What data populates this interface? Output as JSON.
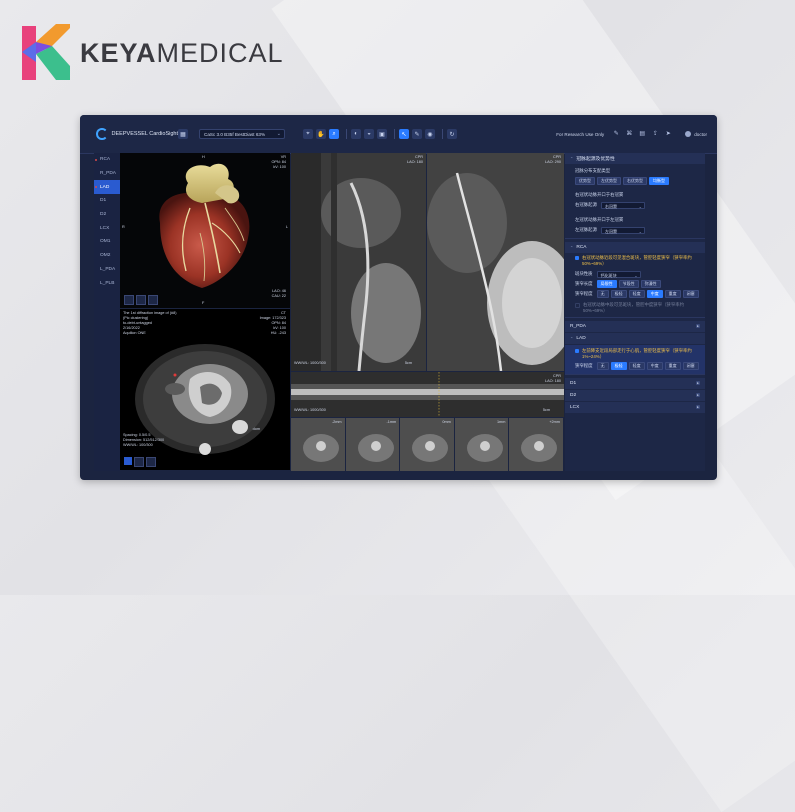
{
  "logo": {
    "bold": "KEYA",
    "regular": "MEDICAL"
  },
  "app": {
    "brand": "DEEPVESSEL CardioSight",
    "series": "CaSc 3.0 B35f BestDiast 63%",
    "research_note": "For Research Use Only",
    "user": "doctor",
    "tool_icons": [
      "grid-icon",
      "target-icon",
      "hand-icon",
      "zoom-icon",
      "contrast-icon",
      "window-icon",
      "camera-icon",
      "cursor-icon",
      "brush-icon",
      "eye-icon",
      "refresh-icon"
    ],
    "right_icons": [
      "edit-icon",
      "network-icon",
      "report-icon",
      "export-icon",
      "send-icon"
    ]
  },
  "vessels": [
    {
      "label": "RCA",
      "flag": true
    },
    {
      "label": "R_PDA",
      "flag": false
    },
    {
      "label": "LAD",
      "flag": true,
      "active": true
    },
    {
      "label": "D1",
      "flag": false
    },
    {
      "label": "D2",
      "flag": false
    },
    {
      "label": "LCX",
      "flag": false
    },
    {
      "label": "OM1",
      "flag": false
    },
    {
      "label": "OM2",
      "flag": false
    },
    {
      "label": "L_PDA",
      "flag": false
    },
    {
      "label": "L_PLB",
      "flag": false
    }
  ],
  "vr_view": {
    "top": "H",
    "tr": "VR\nOPN: 84\nkV: 100",
    "br": "LAO: 46\nCAU: 22",
    "bottom": "F",
    "left": "R",
    "right": "L"
  },
  "axial_view": {
    "tl": "The 1st diffraction image of (#8)\n(Pic clustering)\nto-debt-untagged\n2/16/2022\nAquilion ONE",
    "tr": "CT\nImage: 172/323\nOPN: 84\nkV: 100\nHU: -243",
    "bl": "Spacing: 0.5/0.5\nDimension: 512/512/300\nWW/WL: 100/300",
    "side_r": "dom"
  },
  "cpr_view": {
    "tr1": "CPR\nLAO: 180",
    "tr2": "CPR\nLAO: 290",
    "bl": "WW/WL: 1000/300",
    "scale": "5cm",
    "top": "H"
  },
  "straight_view": {
    "tr": "CPR\nLAO: 180",
    "bl": "WW/WL: 1000/300",
    "scale": "5cm"
  },
  "cross_sections": [
    "-2mm",
    "-1mm",
    "0mm",
    "1mm",
    "+2mm"
  ],
  "panel": {
    "dominance": {
      "title": "冠脉起源及优势性",
      "q": "冠脉分布支配类型",
      "options": [
        "优势型",
        "左优势型",
        "右优势型",
        "均衡型"
      ],
      "selected": 3,
      "right_origin_label": "右冠状动脉开口于右冠窦",
      "right_origin_key": "右冠脉起源",
      "right_origin_val": "右冠窦",
      "left_origin_label": "左冠状动脉开口于左冠窦",
      "left_origin_key": "左冠脉起源",
      "left_origin_val": "左冠窦"
    },
    "rca": {
      "title": "RCA",
      "finding": "右冠状动脉近段可见混合斑块，管腔轻度狭窄（狭窄率约50%~69%）",
      "nature_key": "斑块性质",
      "nature_val": "钙化斑块",
      "length_key": "狭窄长度",
      "length_opts": [
        "局限性",
        "节段性",
        "弥漫性"
      ],
      "length_sel": 0,
      "degree_key": "狭窄程度",
      "degree_opts": [
        "无",
        "极轻",
        "轻度",
        "中度",
        "重度",
        "闭塞"
      ],
      "degree_sel": 3,
      "extra": "右冠状动脉中段可见斑块，管腔中度狭窄（狭窄率约50%~69%）"
    },
    "r_pda": {
      "title": "R_PDA"
    },
    "lad": {
      "title": "LAD",
      "finding": "左前降支近段局部走行于心肌，管腔轻度狭窄（狭窄率约1%~24%）",
      "degree_key": "狭窄程度",
      "degree_opts": [
        "无",
        "极轻",
        "轻度",
        "中度",
        "重度",
        "闭塞"
      ],
      "degree_sel": 1
    },
    "d1": {
      "title": "D1"
    },
    "d2": {
      "title": "D2"
    },
    "lcx": {
      "title": "LCX"
    }
  }
}
